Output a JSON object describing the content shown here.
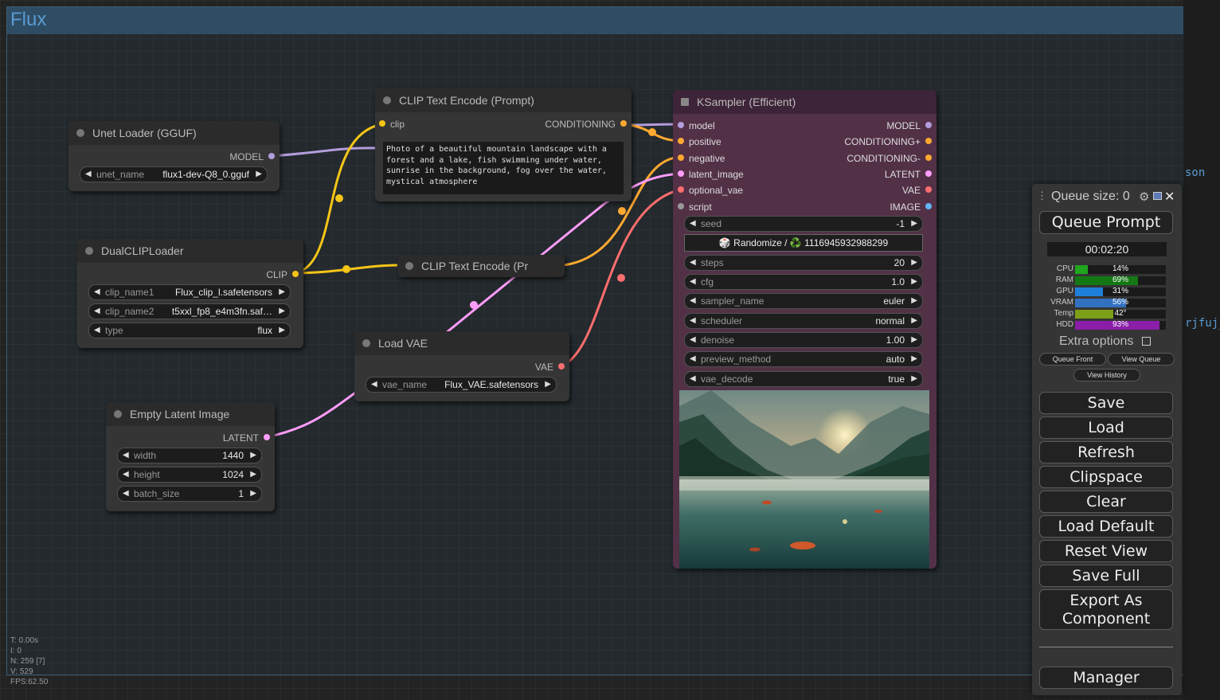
{
  "group": {
    "title": "Flux"
  },
  "right_strip": {
    "text1": "son",
    "text2": "rjfuj_"
  },
  "colors": {
    "clip_link": "#f5c518",
    "model_link": "#b39ddb",
    "conditioning": "#ffa931",
    "latent": "#ff9cf9",
    "vae": "#ff6e6e",
    "ksampler_bg": "#523147"
  },
  "nodes": {
    "unet": {
      "title": "Unet Loader (GGUF)",
      "output": "MODEL",
      "widget_label": "unet_name",
      "widget_value": "flux1-dev-Q8_0.gguf"
    },
    "dualclip": {
      "title": "DualCLIPLoader",
      "output": "CLIP",
      "widgets": [
        {
          "label": "clip_name1",
          "value": "Flux_clip_l.safetensors"
        },
        {
          "label": "clip_name2",
          "value": "t5xxl_fp8_e4m3fn.saf…"
        },
        {
          "label": "type",
          "value": "flux"
        }
      ]
    },
    "clip_prompt": {
      "title": "CLIP Text Encode (Prompt)",
      "input": "clip",
      "output": "CONDITIONING",
      "text": "Photo of a beautiful mountain landscape with a forest and a lake, fish swimming under water, sunrise in the background, fog over the water, mystical atmosphere"
    },
    "clip_neg": {
      "title": "CLIP Text Encode (Pr"
    },
    "vae": {
      "title": "Load VAE",
      "output": "VAE",
      "widget_label": "vae_name",
      "widget_value": "Flux_VAE.safetensors"
    },
    "latent": {
      "title": "Empty Latent Image",
      "output": "LATENT",
      "widgets": [
        {
          "label": "width",
          "value": "1440"
        },
        {
          "label": "height",
          "value": "1024"
        },
        {
          "label": "batch_size",
          "value": "1"
        }
      ]
    },
    "ksampler": {
      "title": "KSampler (Efficient)",
      "inputs": [
        "model",
        "positive",
        "negative",
        "latent_image",
        "optional_vae",
        "script"
      ],
      "outputs": [
        "MODEL",
        "CONDITIONING+",
        "CONDITIONING-",
        "LATENT",
        "VAE",
        "IMAGE"
      ],
      "seed": {
        "label": "seed",
        "value": "-1"
      },
      "seed_control": "🎲 Randomize / ♻️ 1116945932988299",
      "widgets": [
        {
          "label": "steps",
          "value": "20"
        },
        {
          "label": "cfg",
          "value": "1.0"
        },
        {
          "label": "sampler_name",
          "value": "euler"
        },
        {
          "label": "scheduler",
          "value": "normal"
        },
        {
          "label": "denoise",
          "value": "1.00"
        },
        {
          "label": "preview_method",
          "value": "auto"
        },
        {
          "label": "vae_decode",
          "value": "true"
        }
      ]
    }
  },
  "panel": {
    "queue_size": "Queue size: 0",
    "queue_prompt": "Queue Prompt",
    "timer": "00:02:20",
    "stats": [
      {
        "label": "CPU",
        "value": "14%",
        "percent": 14,
        "color": "#1fa51f"
      },
      {
        "label": "RAM",
        "value": "69%",
        "percent": 69,
        "color": "#137813"
      },
      {
        "label": "GPU",
        "value": "31%",
        "percent": 31,
        "color": "#1f7fd8"
      },
      {
        "label": "VRAM",
        "value": "56%",
        "percent": 56,
        "color": "#3270c0"
      },
      {
        "label": "Temp",
        "value": "42°",
        "percent": 42,
        "color": "#7c9f16"
      },
      {
        "label": "HDD",
        "value": "93%",
        "percent": 93,
        "color": "#8a1ea8"
      }
    ],
    "extra_options": "Extra options",
    "queue_front": "Queue Front",
    "view_queue": "View Queue",
    "view_history": "View History",
    "buttons": [
      "Save",
      "Load",
      "Refresh",
      "Clipspace",
      "Clear",
      "Load Default",
      "Reset View",
      "Save Full"
    ],
    "export": "Export As Component",
    "manager": "Manager"
  },
  "stats_overlay": [
    "T: 0.00s",
    "I: 0",
    "N: 259 [7]",
    "V: 529",
    "FPS:62.50"
  ]
}
